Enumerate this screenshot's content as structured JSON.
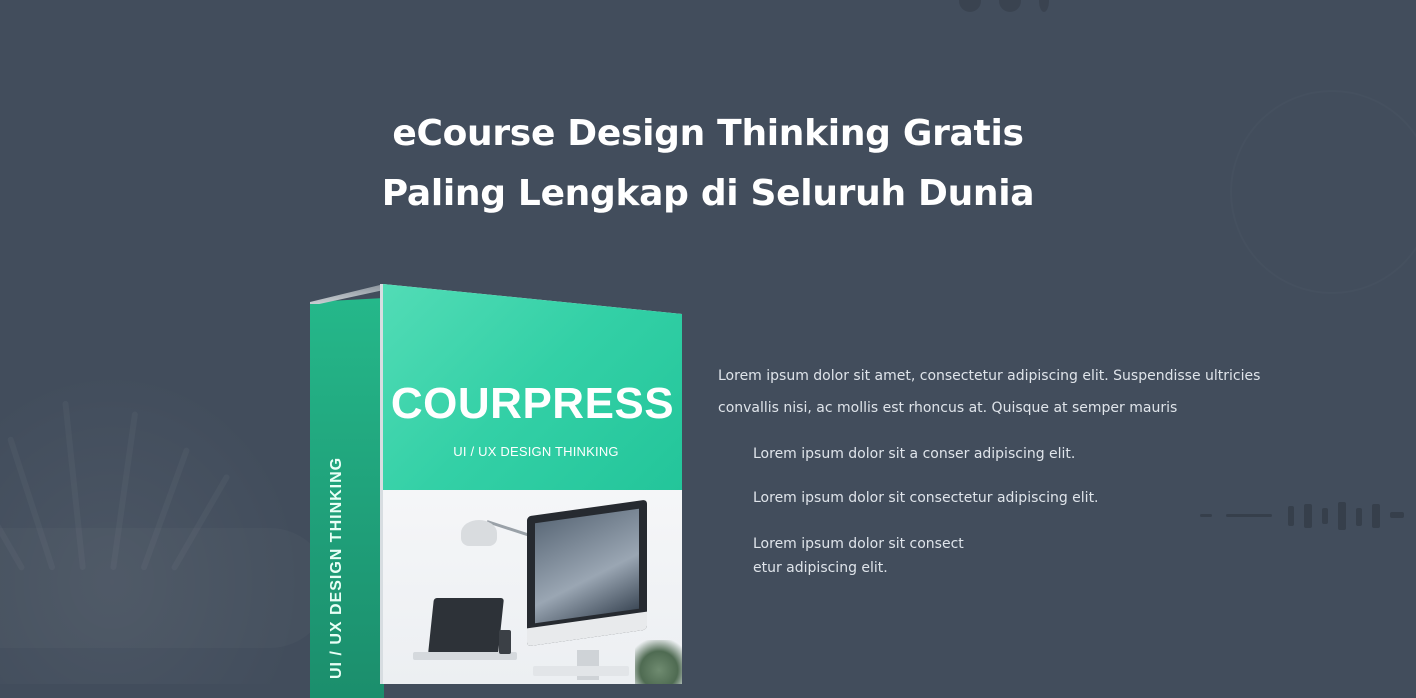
{
  "hero": {
    "title_line1": "eCourse Design Thinking Gratis",
    "title_line2": "Paling Lengkap di Seluruh Dunia"
  },
  "product": {
    "brand": "COURPRESS",
    "subtitle": "UI / UX DESIGN THINKING",
    "spine_label": "UI / UX DESIGN THINKING",
    "colors": {
      "box_green": "#33d0a6",
      "spine_green": "#1f9e78",
      "background": "#424d5c"
    }
  },
  "description": {
    "intro": "Lorem ipsum dolor sit amet, consectetur adipiscing elit. Suspendisse ultricies convallis nisi, ac mollis est rhoncus at. Quisque at semper mauris",
    "bullets": [
      "Lorem ipsum dolor sit a conser adipiscing elit.",
      "Lorem ipsum dolor sit consectetur adipiscing elit.",
      "Lorem ipsum dolor sit consect etur adipiscing elit."
    ]
  }
}
